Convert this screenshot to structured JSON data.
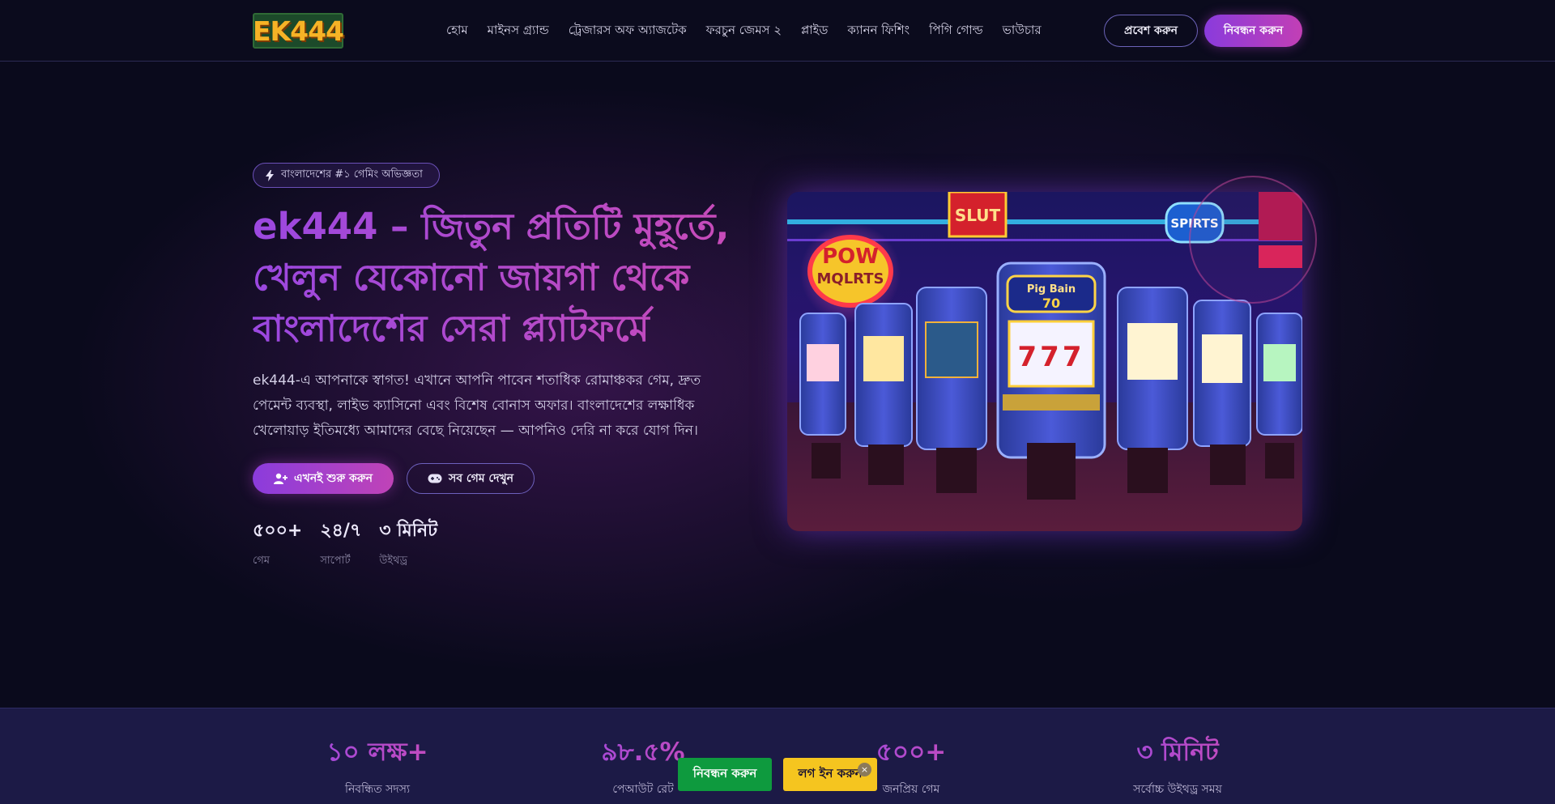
{
  "brand": {
    "logo_text": "EK444"
  },
  "nav": {
    "items": [
      "হোম",
      "মাইনস গ্র্যান্ড",
      "ট্রেজারস অফ অ্যাজটেক",
      "ফরচুন জেমস ২",
      "প্লাইড",
      "ক্যানন ফিশিং",
      "পিগি গোল্ড",
      "ভাউচার"
    ]
  },
  "header_actions": {
    "login_label": "প্রবেশ করুন",
    "register_label": "নিবন্ধন করুন"
  },
  "hero": {
    "badge_text": "বাংলাদেশের #১ গেমিং অভিজ্ঞতা",
    "title_lines": [
      "ek444 – জিতুন প্রতিটি মুহূর্তে,",
      "খেলুন যেকোনো জায়গা থেকে",
      "বাংলাদেশের সেরা প্ল্যাটফর্মে"
    ],
    "description": "ek444-এ আপনাকে স্বাগত! এখানে আপনি পাবেন শতাধিক রোমাঞ্চকর গেম, দ্রুত পেমেন্ট ব্যবস্থা, লাইভ ক্যাসিনো এবং বিশেষ বোনাস অফার। বাংলাদেশের লক্ষাধিক খেলোয়াড় ইতিমধ্যে আমাদের বেছে নিয়েছেন — আপনিও দেরি না করে যোগ দিন।",
    "cta_primary": "এখনই শুরু করুন",
    "cta_secondary": "সব গেম দেখুন",
    "mini_stats": [
      {
        "value": "৫০০+",
        "label": "গেম"
      },
      {
        "value": "২৪/৭",
        "label": "সাপোর্ট"
      },
      {
        "value": "৩ মিনিট",
        "label": "উইথড্র"
      }
    ],
    "image_sign_texts": [
      "SLUT",
      "POW",
      "MQLRTS",
      "Pig Bain",
      "70",
      "SPIRTS",
      "777"
    ]
  },
  "stats_band": [
    {
      "value": "১০ লক্ষ+",
      "label": "নিবন্ধিত সদস্য"
    },
    {
      "value": "৯৮.৫%",
      "label": "পেআউট রেট"
    },
    {
      "value": "৫০০+",
      "label": "জনপ্রিয় গেম"
    },
    {
      "value": "৩ মিনিট",
      "label": "সর্বোচ্চ উইথড্র সময়"
    }
  ],
  "sticky": {
    "register_label": "নিবন্ধন করুন",
    "login_label": "লগ ইন করুন",
    "close_glyph": "×"
  },
  "colors": {
    "accent_start": "#8b3cdc",
    "accent_end": "#c243b7",
    "logo_gold": "#f6b326",
    "register_green": "#0e9a3e",
    "login_yellow": "#f5c51f"
  }
}
